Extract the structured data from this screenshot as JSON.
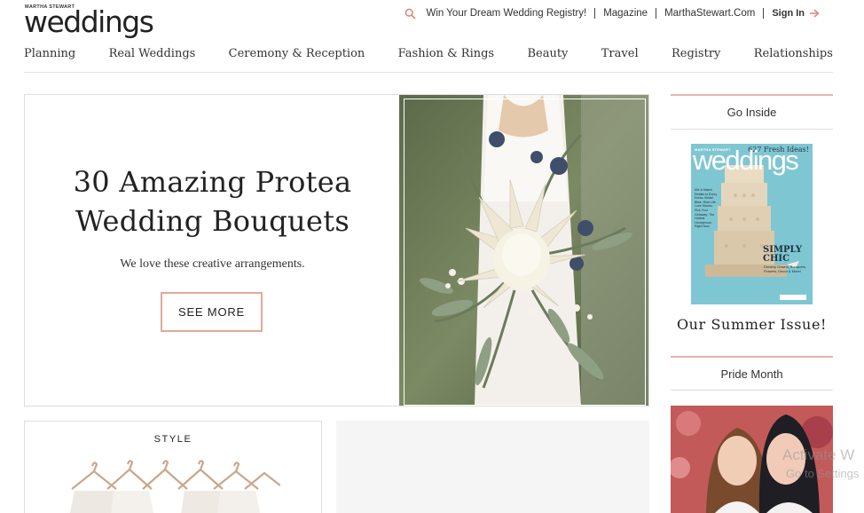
{
  "header": {
    "brand_small": "MARTHA STEWART",
    "brand_name": "weddings",
    "util_links": [
      "Win Your Dream Wedding Registry!",
      "Magazine",
      "MarthaStewart.Com"
    ],
    "signin_label": "Sign In",
    "accent_color": "#e3a99b"
  },
  "nav": {
    "items": [
      "Planning",
      "Real Weddings",
      "Ceremony & Reception",
      "Fashion & Rings",
      "Beauty",
      "Travel",
      "Registry",
      "Relationships"
    ]
  },
  "hero": {
    "title_line1": "30 Amazing Protea",
    "title_line2": "Wedding Bouquets",
    "subtitle": "We love these creative arrangements.",
    "cta_label": "SEE MORE"
  },
  "sidebar": {
    "go_inside_label": "Go Inside",
    "cover": {
      "brand": "MARTHA STEWART",
      "title": "weddings",
      "ideas": "627 Fresh Ideas!",
      "headline": "SIMPLY CHIC",
      "headline_sub": "Dreamy Gowns, Bouquets, Flowers, Decor & More!",
      "side_text": "Mix & Match Details to Every Dress. Bridal Bliss: Real Life Love Stories. Pick Your Getaway: The Hottest Honeymoon Right Now"
    },
    "cover_caption": "Our Summer Issue!",
    "pride_label": "Pride Month"
  },
  "cards": {
    "style_label": "STYLE"
  },
  "overlay": {
    "line1": "Activate W",
    "line2": "Go to Settings"
  }
}
